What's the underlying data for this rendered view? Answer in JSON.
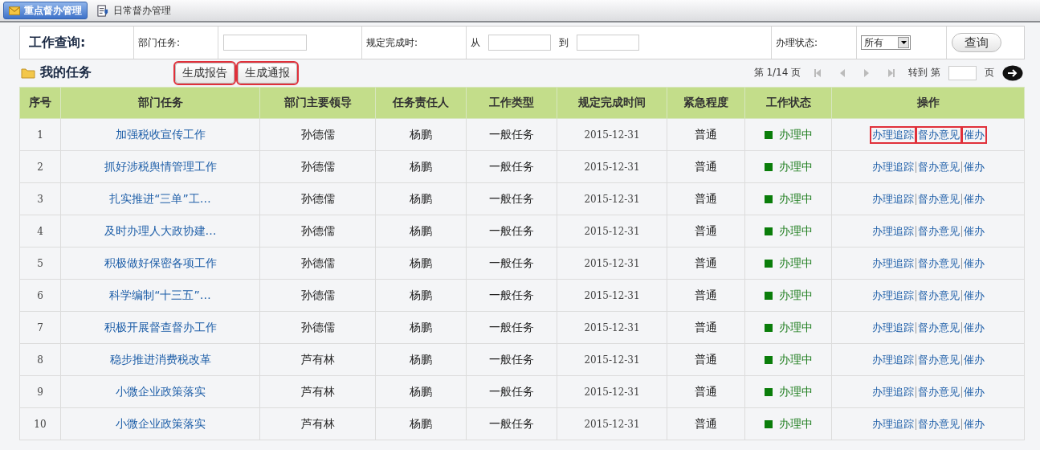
{
  "top_tabs": [
    {
      "label": "重点督办管理",
      "selected": true
    },
    {
      "label": "日常督办管理",
      "selected": false
    }
  ],
  "query": {
    "title": "工作查询:",
    "task_label": "部门任务:",
    "due_label": "规定完成时:",
    "from_label": "从",
    "to_label": "到",
    "status_label": "办理状态:",
    "status_value": "所有",
    "button": "查询"
  },
  "tasks": {
    "title": "我的任务",
    "buttons": [
      {
        "label": "生成报告",
        "highlighted": true
      },
      {
        "label": "生成通报",
        "highlighted": true
      }
    ]
  },
  "pager": {
    "page_text": "第 1/14 页",
    "goto_label": "转到 第",
    "page_suffix": "页"
  },
  "table": {
    "columns": [
      "序号",
      "部门任务",
      "部门主要领导",
      "任务责任人",
      "工作类型",
      "规定完成时间",
      "紧急程度",
      "工作状态",
      "操作"
    ],
    "rows": [
      {
        "no": "1",
        "task": "加强税收宣传工作",
        "leader": "孙德儒",
        "owner": "杨鹏",
        "type": "一般任务",
        "due": "2015-12-31",
        "urgency": "普通",
        "status": "办理中",
        "actions": [
          {
            "label": "办理追踪",
            "highlighted": true
          },
          {
            "label": "督办意见",
            "highlighted": true
          },
          {
            "label": "催办",
            "highlighted": true
          }
        ]
      },
      {
        "no": "2",
        "task": "抓好涉税舆情管理工作",
        "leader": "孙德儒",
        "owner": "杨鹏",
        "type": "一般任务",
        "due": "2015-12-31",
        "urgency": "普通",
        "status": "办理中",
        "actions": [
          {
            "label": "办理追踪",
            "highlighted": false
          },
          {
            "label": "督办意见",
            "highlighted": false
          },
          {
            "label": "催办",
            "highlighted": false
          }
        ]
      },
      {
        "no": "3",
        "task": "扎实推进“三单”工…",
        "leader": "孙德儒",
        "owner": "杨鹏",
        "type": "一般任务",
        "due": "2015-12-31",
        "urgency": "普通",
        "status": "办理中",
        "actions": [
          {
            "label": "办理追踪",
            "highlighted": false
          },
          {
            "label": "督办意见",
            "highlighted": false
          },
          {
            "label": "催办",
            "highlighted": false
          }
        ]
      },
      {
        "no": "4",
        "task": "及时办理人大政协建…",
        "leader": "孙德儒",
        "owner": "杨鹏",
        "type": "一般任务",
        "due": "2015-12-31",
        "urgency": "普通",
        "status": "办理中",
        "actions": [
          {
            "label": "办理追踪",
            "highlighted": false
          },
          {
            "label": "督办意见",
            "highlighted": false
          },
          {
            "label": "催办",
            "highlighted": false
          }
        ]
      },
      {
        "no": "5",
        "task": "积极做好保密各项工作",
        "leader": "孙德儒",
        "owner": "杨鹏",
        "type": "一般任务",
        "due": "2015-12-31",
        "urgency": "普通",
        "status": "办理中",
        "actions": [
          {
            "label": "办理追踪",
            "highlighted": false
          },
          {
            "label": "督办意见",
            "highlighted": false
          },
          {
            "label": "催办",
            "highlighted": false
          }
        ]
      },
      {
        "no": "6",
        "task": "科学编制“十三五”…",
        "leader": "孙德儒",
        "owner": "杨鹏",
        "type": "一般任务",
        "due": "2015-12-31",
        "urgency": "普通",
        "status": "办理中",
        "actions": [
          {
            "label": "办理追踪",
            "highlighted": false
          },
          {
            "label": "督办意见",
            "highlighted": false
          },
          {
            "label": "催办",
            "highlighted": false
          }
        ]
      },
      {
        "no": "7",
        "task": "积极开展督查督办工作",
        "leader": "孙德儒",
        "owner": "杨鹏",
        "type": "一般任务",
        "due": "2015-12-31",
        "urgency": "普通",
        "status": "办理中",
        "actions": [
          {
            "label": "办理追踪",
            "highlighted": false
          },
          {
            "label": "督办意见",
            "highlighted": false
          },
          {
            "label": "催办",
            "highlighted": false
          }
        ]
      },
      {
        "no": "8",
        "task": "稳步推进消费税改革",
        "leader": "芦有林",
        "owner": "杨鹏",
        "type": "一般任务",
        "due": "2015-12-31",
        "urgency": "普通",
        "status": "办理中",
        "actions": [
          {
            "label": "办理追踪",
            "highlighted": false
          },
          {
            "label": "督办意见",
            "highlighted": false
          },
          {
            "label": "催办",
            "highlighted": false
          }
        ]
      },
      {
        "no": "9",
        "task": "小微企业政策落实",
        "leader": "芦有林",
        "owner": "杨鹏",
        "type": "一般任务",
        "due": "2015-12-31",
        "urgency": "普通",
        "status": "办理中",
        "actions": [
          {
            "label": "办理追踪",
            "highlighted": false
          },
          {
            "label": "督办意见",
            "highlighted": false
          },
          {
            "label": "催办",
            "highlighted": false
          }
        ]
      },
      {
        "no": "10",
        "task": "小微企业政策落实",
        "leader": "芦有林",
        "owner": "杨鹏",
        "type": "一般任务",
        "due": "2015-12-31",
        "urgency": "普通",
        "status": "办理中",
        "actions": [
          {
            "label": "办理追踪",
            "highlighted": false
          },
          {
            "label": "督办意见",
            "highlighted": false
          },
          {
            "label": "催办",
            "highlighted": false
          }
        ]
      }
    ]
  }
}
